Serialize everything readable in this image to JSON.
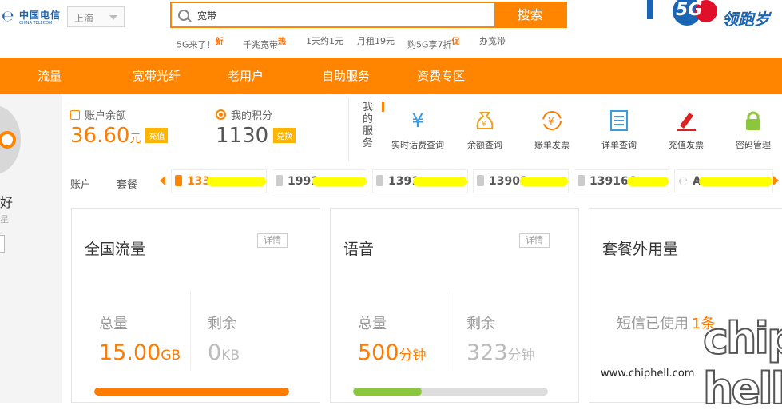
{
  "logo": {
    "cn": "中国电信",
    "en": "CHINA TELECOM"
  },
  "city": {
    "value": "上海"
  },
  "search": {
    "value": "宽带",
    "button": "搜索"
  },
  "hot_links": [
    {
      "label": "5G来了！",
      "tag": "新"
    },
    {
      "label": "千兆宽带",
      "tag": "热"
    },
    {
      "label": "1天约1元",
      "tag": ""
    },
    {
      "label": "月租19元",
      "tag": ""
    },
    {
      "label": "购5G享7折",
      "tag": "促"
    },
    {
      "label": "办宽带",
      "tag": ""
    }
  ],
  "banner": {
    "badge": "5G",
    "slogan": "领跑岁"
  },
  "nav": [
    "流量",
    "宽带光纤",
    "老用户",
    "自助服务",
    "资费专区"
  ],
  "left": {
    "greeting": "好",
    "level": "星"
  },
  "balance": {
    "label": "账户余额",
    "amount": "36.60",
    "unit": "元",
    "button": "充值"
  },
  "points": {
    "label": "我的积分",
    "value": "1130",
    "button": "兑换"
  },
  "services": {
    "title": "我的服务",
    "items": [
      {
        "label": "实时话费查询",
        "icon": "yuan-icon",
        "color": "#3a9be0"
      },
      {
        "label": "余额查询",
        "icon": "money-bag-icon",
        "color": "#f0a020"
      },
      {
        "label": "账单发票",
        "icon": "bill-refresh-icon",
        "color": "#ff7c00"
      },
      {
        "label": "详单查询",
        "icon": "list-icon",
        "color": "#3a9be0"
      },
      {
        "label": "充值发票",
        "icon": "pen-invoice-icon",
        "color": "#e02020"
      },
      {
        "label": "密码管理",
        "icon": "lock-icon",
        "color": "#8cc63f"
      }
    ]
  },
  "accounts": {
    "label_account": "账户",
    "label_plan": "套餐",
    "items": [
      "133",
      "1991",
      "1391",
      "13901",
      "139166",
      "A"
    ]
  },
  "cards": {
    "data": {
      "title": "全国流量",
      "detail": "详情",
      "total_label": "总量",
      "total": "15.00",
      "total_unit": "GB",
      "remain_label": "剩余",
      "remain": "0",
      "remain_unit": "KB",
      "used_fraction": 1.0,
      "bar_color": "#ff7c00"
    },
    "voice": {
      "title": "语音",
      "detail": "详情",
      "total_label": "总量",
      "total": "500",
      "total_unit": "分钟",
      "remain_label": "剩余",
      "remain": "323",
      "remain_unit": "分钟",
      "used_fraction": 0.354,
      "bar_color": "#8cc63f"
    },
    "extra": {
      "title": "套餐外用量",
      "sms_label": "短信已使用",
      "sms_value": "1条"
    }
  },
  "watermark": {
    "url": "www.chiphell.com",
    "mark": "chip hell"
  }
}
